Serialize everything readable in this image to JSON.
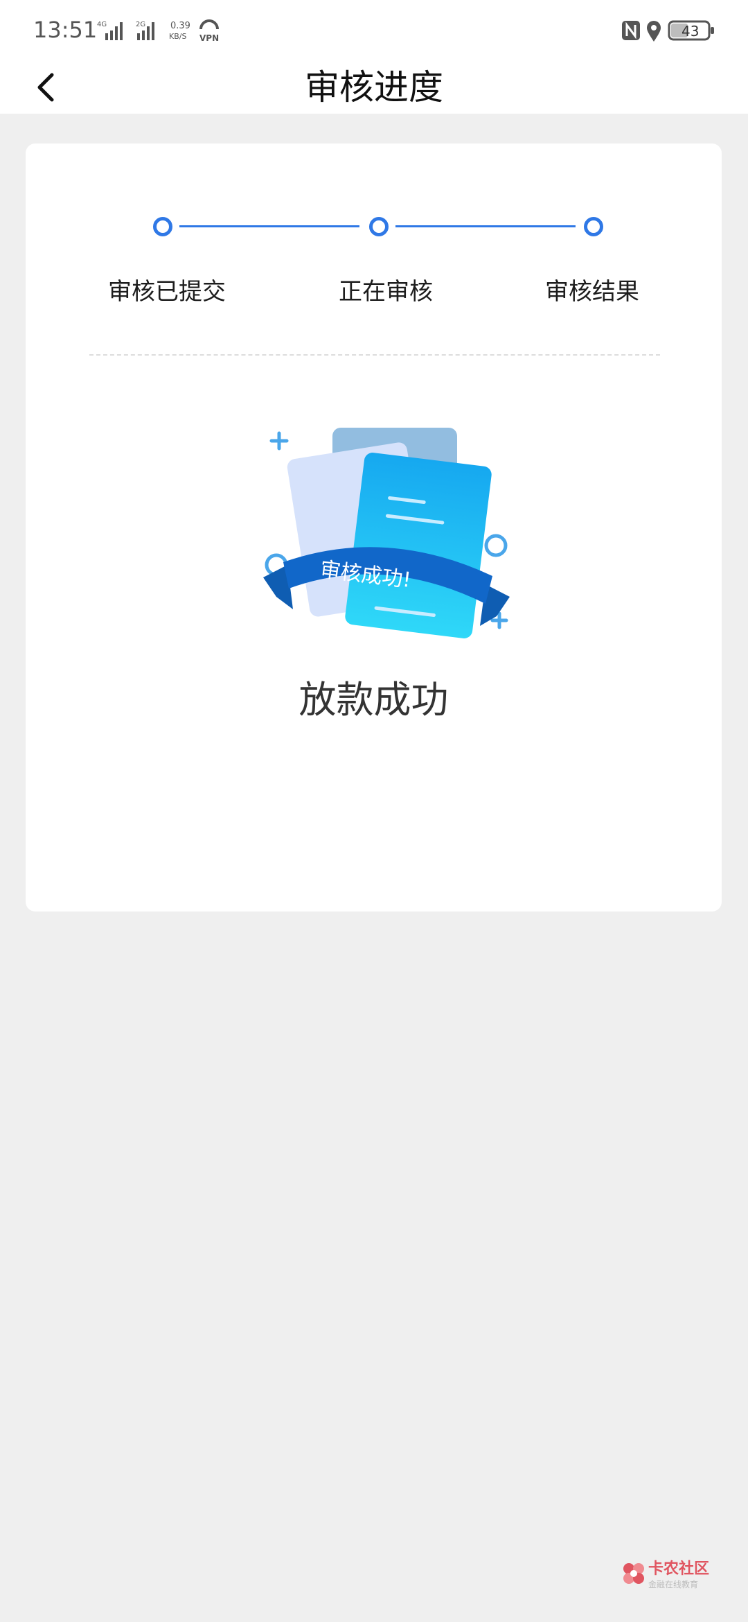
{
  "status_bar": {
    "time": "13:51",
    "net_4g": "4G",
    "net_2g": "2G",
    "speed_value": "0.39",
    "speed_unit": "KB/S",
    "vpn": "VPN",
    "battery": "43",
    "icons": [
      "nfc-icon",
      "location-icon",
      "battery-icon",
      "signal-icon",
      "vpn-icon"
    ]
  },
  "nav": {
    "title": "审核进度",
    "back_icon": "chevron-left-icon"
  },
  "progress": {
    "accent_color": "#2f78e6",
    "steps": [
      {
        "label": "审核已提交"
      },
      {
        "label": "正在审核"
      },
      {
        "label": "审核结果"
      }
    ]
  },
  "result": {
    "badge_text": "审核成功!",
    "title": "放款成功"
  },
  "watermark": {
    "title": "卡农社区",
    "subtitle": "金融在线教育"
  }
}
